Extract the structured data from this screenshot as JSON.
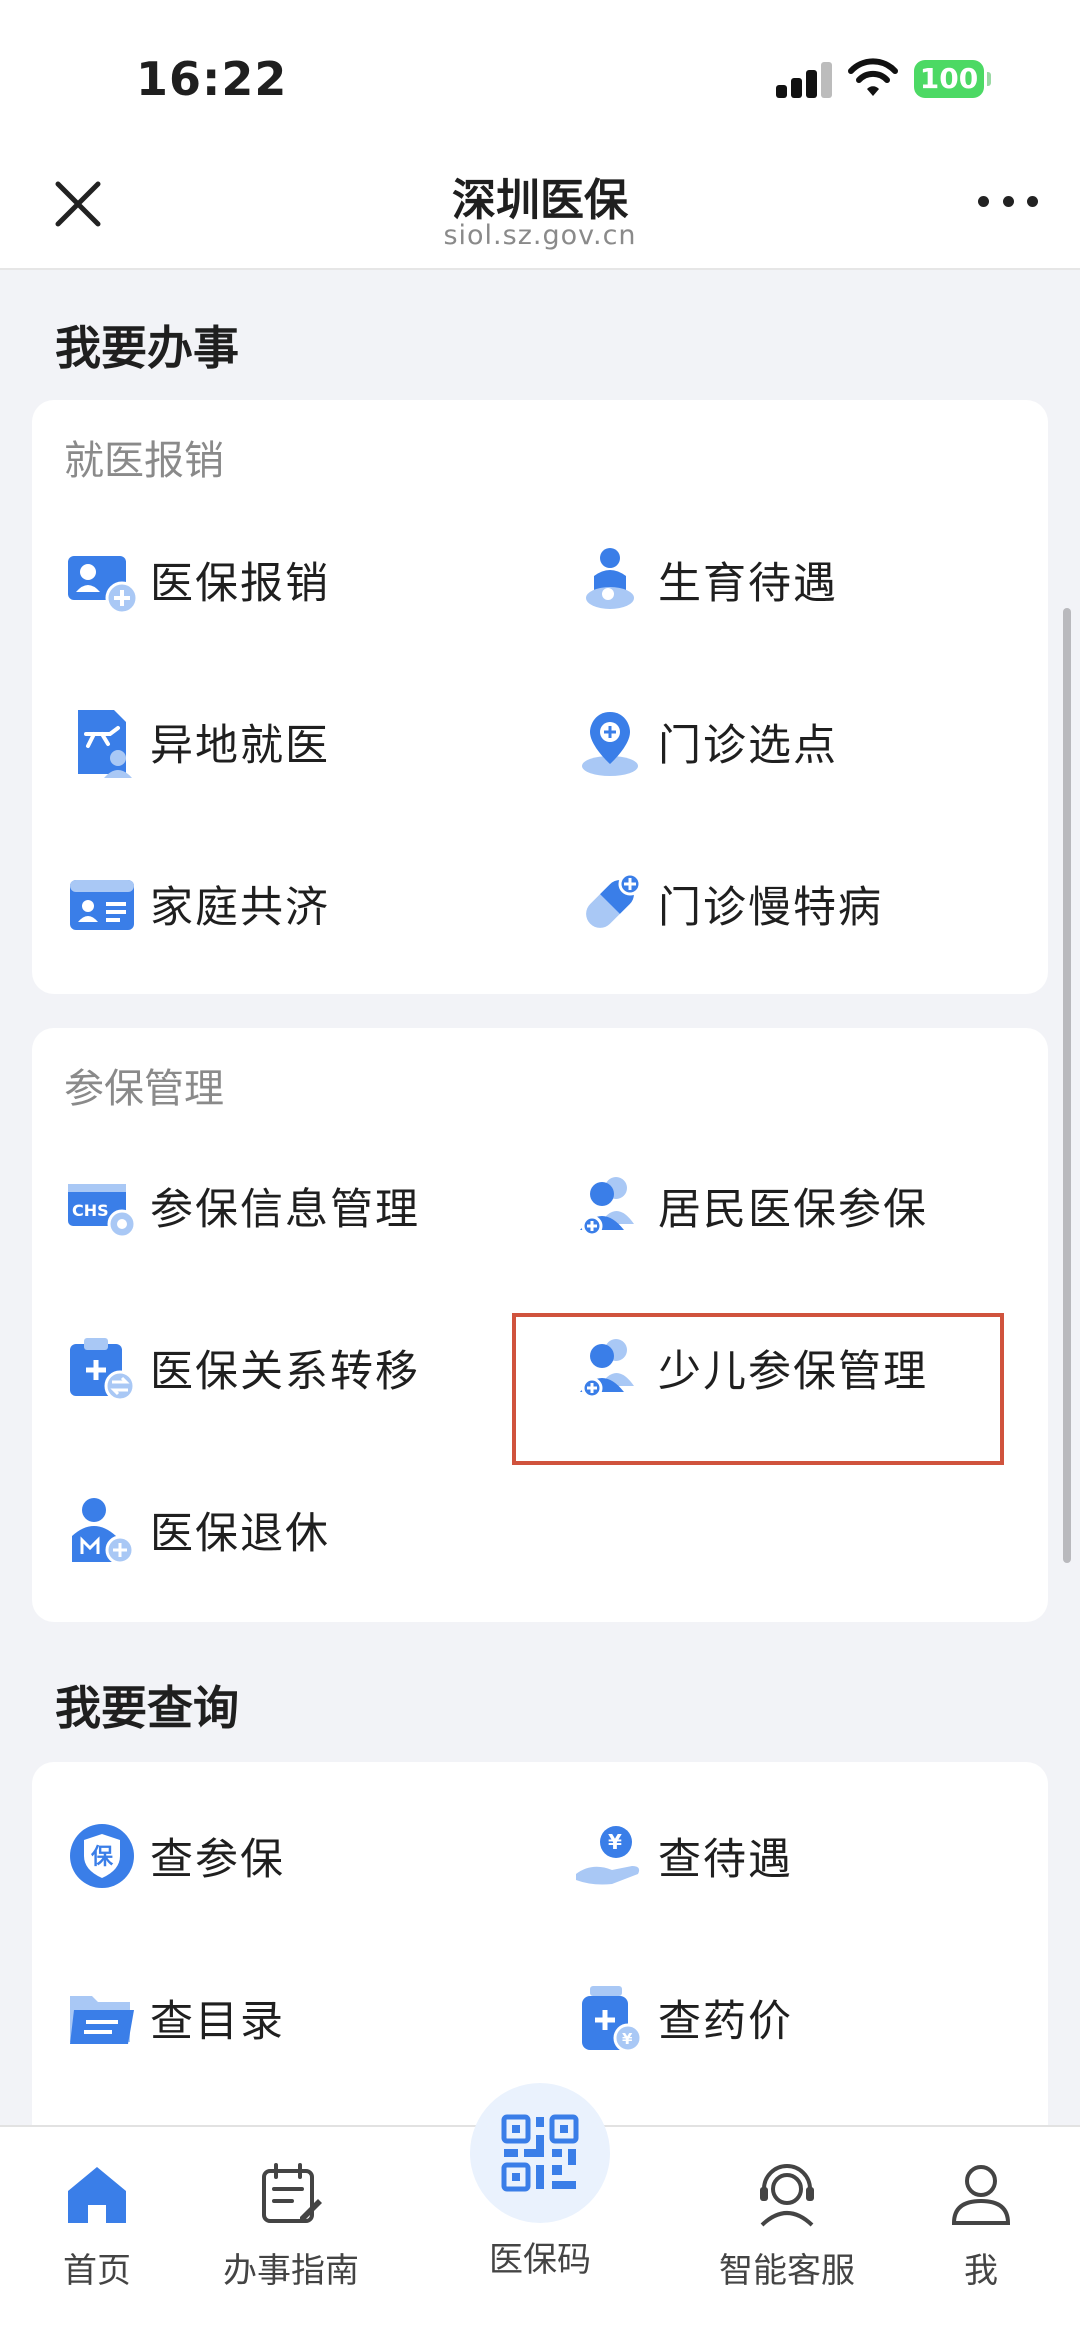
{
  "status_bar": {
    "time": "16:22",
    "battery": "100"
  },
  "nav": {
    "title": "深圳医保",
    "subtitle": "siol.sz.gov.cn"
  },
  "sections": {
    "do_title": "我要办事",
    "query_title": "我要查询"
  },
  "cards": {
    "medical": {
      "title": "就医报销",
      "items": [
        {
          "label": "医保报销",
          "icon": "reimbursement-icon"
        },
        {
          "label": "生育待遇",
          "icon": "maternity-icon"
        },
        {
          "label": "异地就医",
          "icon": "remote-medical-icon"
        },
        {
          "label": "门诊选点",
          "icon": "clinic-location-icon"
        },
        {
          "label": "家庭共济",
          "icon": "family-card-icon"
        },
        {
          "label": "门诊慢特病",
          "icon": "pill-icon"
        }
      ]
    },
    "insurance": {
      "title": "参保管理",
      "items": [
        {
          "label": "参保信息管理",
          "icon": "chs-settings-icon"
        },
        {
          "label": "居民医保参保",
          "icon": "resident-users-icon"
        },
        {
          "label": "医保关系转移",
          "icon": "transfer-clipboard-icon"
        },
        {
          "label": "少儿参保管理",
          "icon": "child-users-icon"
        },
        {
          "label": "医保退休",
          "icon": "retirement-icon"
        }
      ]
    },
    "query": {
      "items": [
        {
          "label": "查参保",
          "icon": "shield-icon"
        },
        {
          "label": "查待遇",
          "icon": "yuan-hand-icon"
        },
        {
          "label": "查目录",
          "icon": "folder-icon"
        },
        {
          "label": "查药价",
          "icon": "medicine-bottle-icon"
        }
      ]
    }
  },
  "tabs": [
    {
      "label": "首页",
      "icon": "home-icon"
    },
    {
      "label": "办事指南",
      "icon": "guide-icon"
    },
    {
      "label": "医保码",
      "icon": "qr-code-icon"
    },
    {
      "label": "智能客服",
      "icon": "customer-service-icon"
    },
    {
      "label": "我",
      "icon": "user-icon"
    }
  ],
  "colors": {
    "primary": "#3a7ee8",
    "light_blue": "#a9c8f5",
    "highlight": "#d0533d",
    "background": "#f2f3f7"
  }
}
